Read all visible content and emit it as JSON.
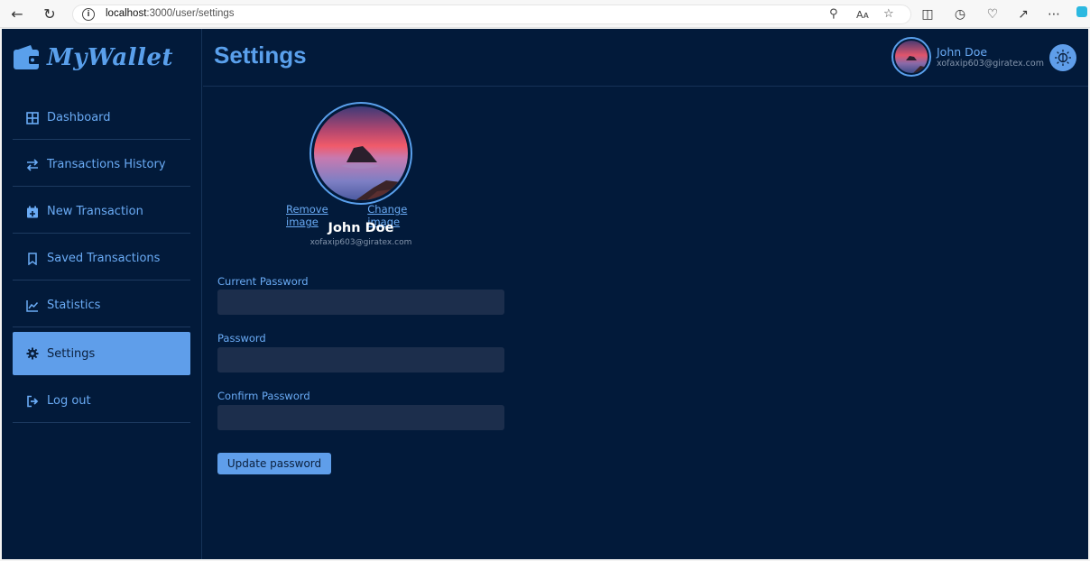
{
  "browser": {
    "url_host": "localhost",
    "url_rest": ":3000/user/settings"
  },
  "app": {
    "logo_text": "MyWallet",
    "page_title": "Settings"
  },
  "sidebar": {
    "items": [
      {
        "label": "Dashboard",
        "icon": "grid-icon"
      },
      {
        "label": "Transactions History",
        "icon": "swap-arrows-icon"
      },
      {
        "label": "New Transaction",
        "icon": "calendar-plus-icon"
      },
      {
        "label": "Saved Transactions",
        "icon": "bookmark-icon"
      },
      {
        "label": "Statistics",
        "icon": "line-chart-icon"
      },
      {
        "label": "Settings",
        "icon": "gear-icon",
        "active": true
      },
      {
        "label": "Log out",
        "icon": "logout-icon"
      }
    ]
  },
  "user": {
    "name": "John Doe",
    "email": "xofaxip603@giratex.com"
  },
  "profile": {
    "remove_image": "Remove image",
    "change_image": "Change image"
  },
  "form": {
    "current_password_label": "Current Password",
    "password_label": "Password",
    "confirm_password_label": "Confirm Password",
    "current_password_value": "",
    "password_value": "",
    "confirm_password_value": "",
    "submit_label": "Update password"
  },
  "colors": {
    "background": "#021a3a",
    "accent": "#5f9eea",
    "text_accent": "#6aabf5",
    "input_bg": "#1c2e4c"
  }
}
